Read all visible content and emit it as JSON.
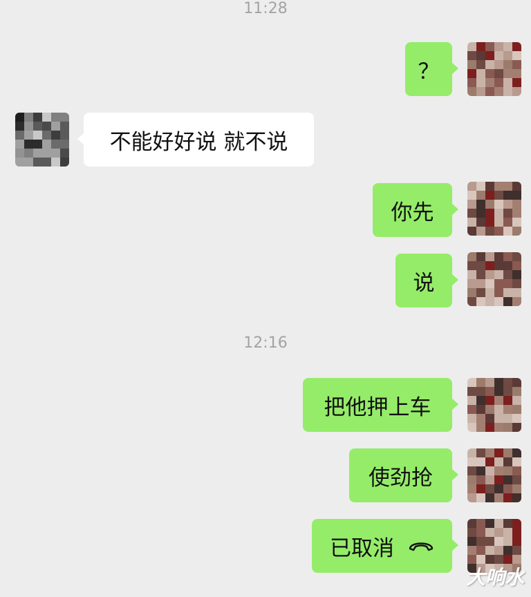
{
  "chat": {
    "timestamps": [
      "11:28",
      "12:16"
    ],
    "messages": [
      {
        "from": "me",
        "text": "？"
      },
      {
        "from": "other",
        "text": "不能好好说  就不说"
      },
      {
        "from": "me",
        "text": "你先"
      },
      {
        "from": "me",
        "text": "说"
      },
      {
        "from": "me",
        "text": "把他押上车"
      },
      {
        "from": "me",
        "text": "使劲抢"
      },
      {
        "from": "me",
        "text": "已取消",
        "icon": "hang-up-phone-icon"
      }
    ]
  },
  "colors": {
    "background": "#ededed",
    "sent_bubble": "#95ec69",
    "received_bubble": "#ffffff",
    "timestamp_text": "#a3a3a3"
  },
  "watermark": "大响水"
}
